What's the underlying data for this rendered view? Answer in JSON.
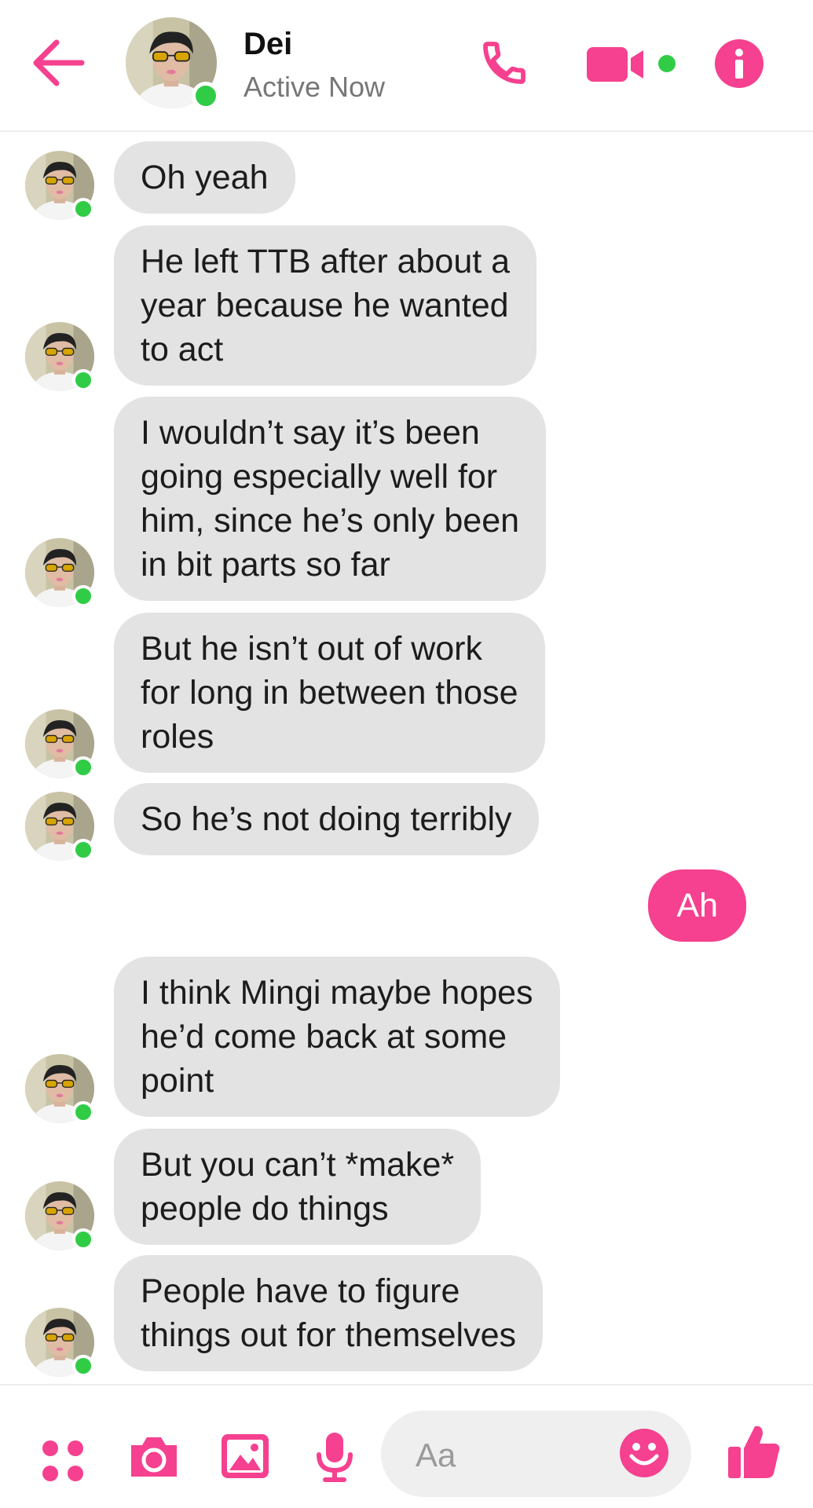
{
  "colors": {
    "accent": "#f5418f",
    "online": "#31cc46",
    "incoming_bubble": "#e3e3e3"
  },
  "header": {
    "contact_name": "Dei",
    "status_text": "Active Now",
    "icons": [
      "arrow-left-icon",
      "phone-icon",
      "video-camera-icon",
      "info-icon"
    ]
  },
  "messages": [
    {
      "sender": "them",
      "text": "Oh yeah"
    },
    {
      "sender": "them",
      "text": "He left TTB after about a\nyear because he wanted\nto act"
    },
    {
      "sender": "them",
      "text": "I wouldn’t say it’s been\ngoing especially well for\nhim, since he’s only been\nin bit parts so far"
    },
    {
      "sender": "them",
      "text": "But he isn’t out of work\nfor long in between those\nroles"
    },
    {
      "sender": "them",
      "text": "So he’s not doing terribly"
    },
    {
      "sender": "me",
      "text": "Ah"
    },
    {
      "sender": "them",
      "text": "I think Mingi maybe hopes\nhe’d come back at some\npoint"
    },
    {
      "sender": "them",
      "text": "But you can’t *make*\npeople do things"
    },
    {
      "sender": "them",
      "text": "People have to figure\nthings out for themselves"
    }
  ],
  "composer": {
    "placeholder": "Aa",
    "icons": [
      "apps-grid-icon",
      "camera-icon",
      "image-icon",
      "microphone-icon",
      "smiley-icon",
      "thumbs-up-icon"
    ]
  }
}
